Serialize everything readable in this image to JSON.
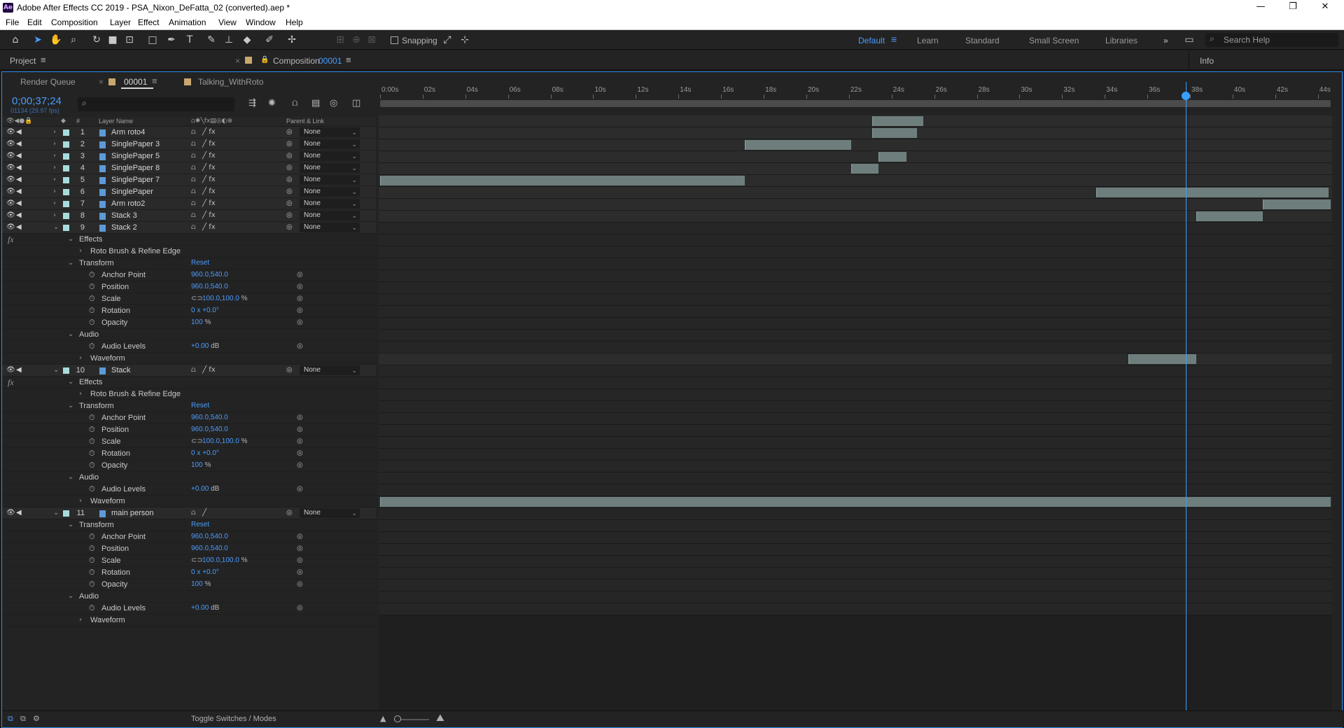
{
  "window": {
    "title": "Adobe After Effects CC 2019 - PSA_Nixon_DeFatta_02 (converted).aep *",
    "app_badge": "Ae",
    "controls": [
      "—",
      "❐",
      "✕"
    ]
  },
  "menu": [
    "File",
    "Edit",
    "Composition",
    "Layer",
    "Effect",
    "Animation",
    "View",
    "Window",
    "Help"
  ],
  "toolbar": {
    "snapping_label": "Snapping",
    "workspaces": [
      "Default",
      "Learn",
      "Standard",
      "Small Screen",
      "Libraries"
    ],
    "active_workspace": "Default",
    "more": "»",
    "search_placeholder": "Search Help"
  },
  "panels": {
    "project": "Project",
    "composition_prefix": "Composition",
    "composition_name": "00001",
    "info": "Info"
  },
  "timeline": {
    "tabs": [
      "Render Queue",
      "00001",
      "Talking_WithRoto"
    ],
    "active_tab": "00001",
    "timecode": "0;00;37;24",
    "fps": "01134 (29.97 fps)",
    "columns": {
      "num": "#",
      "name": "Layer Name",
      "parent": "Parent & Link"
    },
    "ticks": [
      "0:00s",
      "02s",
      "04s",
      "06s",
      "08s",
      "10s",
      "12s",
      "14s",
      "16s",
      "18s",
      "20s",
      "22s",
      "24s",
      "26s",
      "28s",
      "30s",
      "32s",
      "34s",
      "36s",
      "38s",
      "40s",
      "42s",
      "44s"
    ],
    "ruler_partial": [
      "0s"
    ],
    "cti_seconds": 37.8,
    "duration_seconds": 44.6,
    "toggle_label": "Toggle Switches / Modes"
  },
  "layers": [
    {
      "num": "1",
      "name": "Arm roto4",
      "parent": "None",
      "in": 23.1,
      "out": 25.5
    },
    {
      "num": "2",
      "name": "SinglePaper 3",
      "parent": "None",
      "in": 23.1,
      "out": 25.2
    },
    {
      "num": "3",
      "name": "SinglePaper 5",
      "parent": "None",
      "in": 17.1,
      "out": 22.1
    },
    {
      "num": "4",
      "name": "SinglePaper 8",
      "parent": "None",
      "in": 23.4,
      "out": 24.7
    },
    {
      "num": "5",
      "name": "SinglePaper 7",
      "parent": "None",
      "in": 22.1,
      "out": 23.4
    },
    {
      "num": "6",
      "name": "SinglePaper",
      "parent": "None",
      "in": 0.0,
      "out": 17.1
    },
    {
      "num": "7",
      "name": "Arm roto2",
      "parent": "None",
      "in": 33.6,
      "out": 44.5
    },
    {
      "num": "8",
      "name": "Stack 3",
      "parent": "None",
      "in": 41.4,
      "out": 44.6
    },
    {
      "num": "9",
      "name": "Stack 2",
      "parent": "None",
      "in": 38.3,
      "out": 41.4
    },
    {
      "num": "10",
      "name": "Stack",
      "parent": "None",
      "in": 35.1,
      "out": 38.3
    },
    {
      "num": "11",
      "name": "main person",
      "parent": "None",
      "in": 0.0,
      "out": 44.6
    }
  ],
  "props": {
    "effects": "Effects",
    "roto": "Roto Brush & Refine Edge",
    "transform": "Transform",
    "reset": "Reset",
    "anchor": "Anchor Point",
    "anchor_val": "960.0,540.0",
    "position": "Position",
    "position_val": "960.0,540.0",
    "scale": "Scale",
    "scale_val": "100.0,100.0",
    "scale_unit": "%",
    "rotation": "Rotation",
    "rotation_val": "0 x +0.0°",
    "opacity": "Opacity",
    "opacity_val": "100",
    "opacity_unit": "%",
    "audio": "Audio",
    "audio_levels": "Audio Levels",
    "audio_val": "+0.00",
    "audio_unit": "dB",
    "waveform": "Waveform"
  },
  "colors": {
    "accent": "#3aa0ff",
    "label_aqua": "#a8dcdc",
    "bar": "#6d7e7d"
  }
}
